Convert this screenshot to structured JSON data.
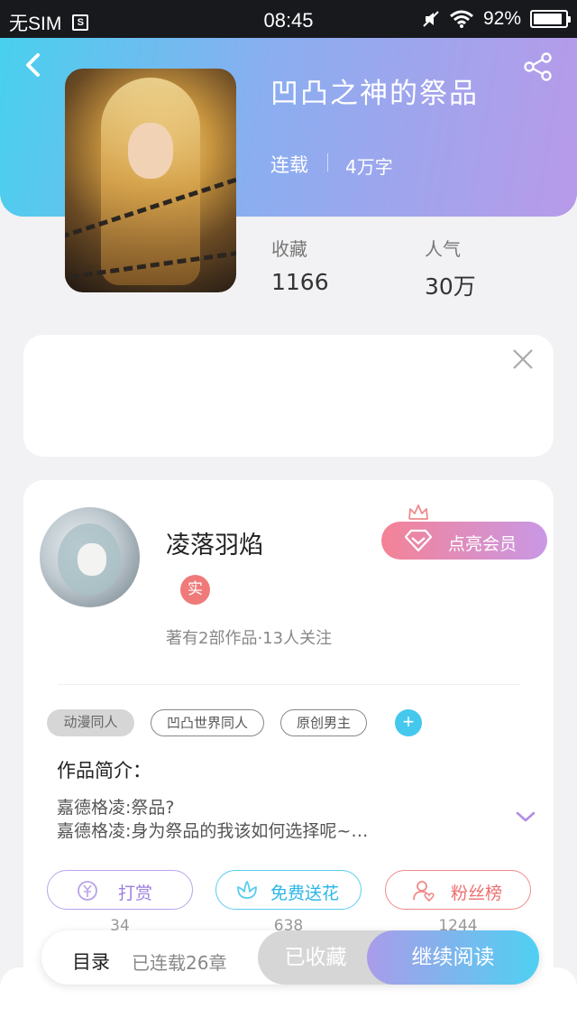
{
  "status_bar": {
    "carrier": "无SIM",
    "sim_icon_text": "S",
    "time": "08:45",
    "battery": "92%",
    "battery_level": 0.92,
    "icons": [
      "sim-card-icon",
      "mute-icon",
      "wifi-icon",
      "battery-icon"
    ]
  },
  "header": {
    "back_icon": "chevron-left-icon",
    "share_icon": "share-icon",
    "title": "凹凸之神的祭品",
    "status": "连载",
    "word_count": "4万字",
    "stats": [
      {
        "label": "收藏",
        "value": "1166"
      },
      {
        "label": "人气",
        "value": "30万"
      }
    ]
  },
  "ad_card": {
    "close_icon": "close-icon"
  },
  "author": {
    "name": "凌落羽焰",
    "verified_badge": "实",
    "meta": "著有2部作品·13人关注",
    "vip_button": "点亮会员",
    "vip_icons": [
      "crown-icon",
      "diamond-icon"
    ]
  },
  "tags": [
    "动漫同人",
    "凹凸世界同人",
    "原创男主"
  ],
  "add_tag": "+",
  "intro": {
    "title": "作品简介：",
    "lines": [
      "嘉德格凌:祭品?",
      "嘉德格凌:身为祭品的我该如何选择呢~…"
    ],
    "expand_icon": "chevron-down-icon"
  },
  "actions": [
    {
      "label": "打赏",
      "count": "34",
      "icon": "yen-coin-icon"
    },
    {
      "label": "免费送花",
      "count": "638",
      "icon": "flower-icon"
    },
    {
      "label": "粉丝榜",
      "count": "1244",
      "icon": "user-heart-icon"
    }
  ],
  "bottom_bar": {
    "toc": "目录",
    "chapters": "已连载26章",
    "collect": "已收藏",
    "read": "继续阅读"
  },
  "colors": {
    "header_gradient_start": "#48d0ee",
    "header_gradient_end": "#b89ae9",
    "vip_gradient_start": "#f48296",
    "vip_gradient_end": "#c998e6",
    "tip": "#9b7fe0",
    "flower": "#2bb6e6",
    "fans": "#ee6f6f",
    "read_gradient_start": "#a99ce9",
    "read_gradient_end": "#4fd0f2"
  }
}
